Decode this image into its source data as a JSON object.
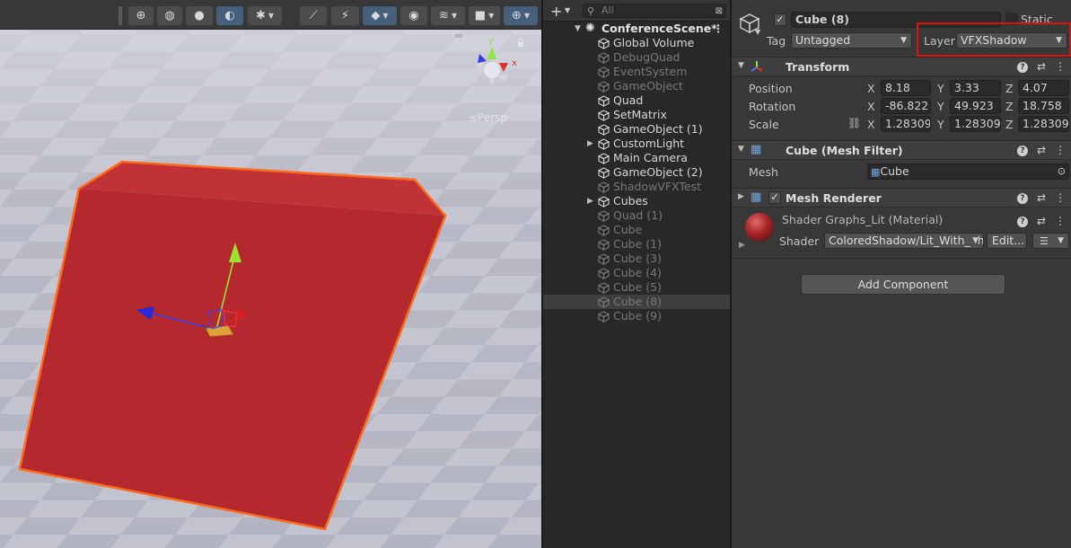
{
  "scene": {
    "persp_label": "≤Persp",
    "toolbar_tools": [
      "globe-wire",
      "globe-shaded",
      "sphere-lit",
      "sphere-dark",
      "bug",
      "fx-off",
      "light-off",
      "layers-blue",
      "eye",
      "stack",
      "camera",
      "gizmo-globe"
    ]
  },
  "hierarchy": {
    "search_placeholder": "All",
    "scene_name": "ConferenceScene*",
    "items": [
      {
        "label": "Global Volume",
        "active": true,
        "fold": false
      },
      {
        "label": "DebugQuad",
        "active": false,
        "fold": false
      },
      {
        "label": "EventSystem",
        "active": false,
        "fold": false
      },
      {
        "label": "GameObject",
        "active": false,
        "fold": false
      },
      {
        "label": "Quad",
        "active": true,
        "fold": false
      },
      {
        "label": "SetMatrix",
        "active": true,
        "fold": false
      },
      {
        "label": "GameObject (1)",
        "active": true,
        "fold": false
      },
      {
        "label": "CustomLight",
        "active": true,
        "fold": true
      },
      {
        "label": "Main Camera",
        "active": true,
        "fold": false
      },
      {
        "label": "GameObject (2)",
        "active": true,
        "fold": false
      },
      {
        "label": "ShadowVFXTest",
        "active": false,
        "fold": false
      },
      {
        "label": "Cubes",
        "active": true,
        "fold": true
      },
      {
        "label": "Quad (1)",
        "active": false,
        "fold": false
      },
      {
        "label": "Cube",
        "active": false,
        "fold": false
      },
      {
        "label": "Cube (1)",
        "active": false,
        "fold": false
      },
      {
        "label": "Cube (3)",
        "active": false,
        "fold": false
      },
      {
        "label": "Cube (4)",
        "active": false,
        "fold": false
      },
      {
        "label": "Cube (5)",
        "active": false,
        "fold": false
      },
      {
        "label": "Cube (8)",
        "active": false,
        "fold": false,
        "selected": true
      },
      {
        "label": "Cube (9)",
        "active": false,
        "fold": false
      }
    ]
  },
  "inspector": {
    "object_name": "Cube (8)",
    "static_label": "Static",
    "tag_label": "Tag",
    "tag_value": "Untagged",
    "layer_label": "Layer",
    "layer_value": "VFXShadow",
    "transform": {
      "title": "Transform",
      "position_label": "Position",
      "rotation_label": "Rotation",
      "scale_label": "Scale",
      "position": {
        "x": "8.18",
        "y": "3.33",
        "z": "4.07"
      },
      "rotation": {
        "x": "-86.822",
        "y": "49.923",
        "z": "18.758"
      },
      "scale": {
        "x": "1.283093",
        "y": "1.283093",
        "z": "1.283093"
      },
      "axis_x": "X",
      "axis_y": "Y",
      "axis_z": "Z"
    },
    "mesh_filter": {
      "title": "Cube (Mesh Filter)",
      "mesh_label": "Mesh",
      "mesh_value": "Cube"
    },
    "mesh_renderer": {
      "title": "Mesh Renderer"
    },
    "material": {
      "name": "Shader Graphs_Lit (Material)",
      "shader_label": "Shader",
      "shader_value": "ColoredShadow/Lit_With_Sh",
      "edit_label": "Edit...",
      "color": "#a52426"
    },
    "add_component_label": "Add Component"
  }
}
